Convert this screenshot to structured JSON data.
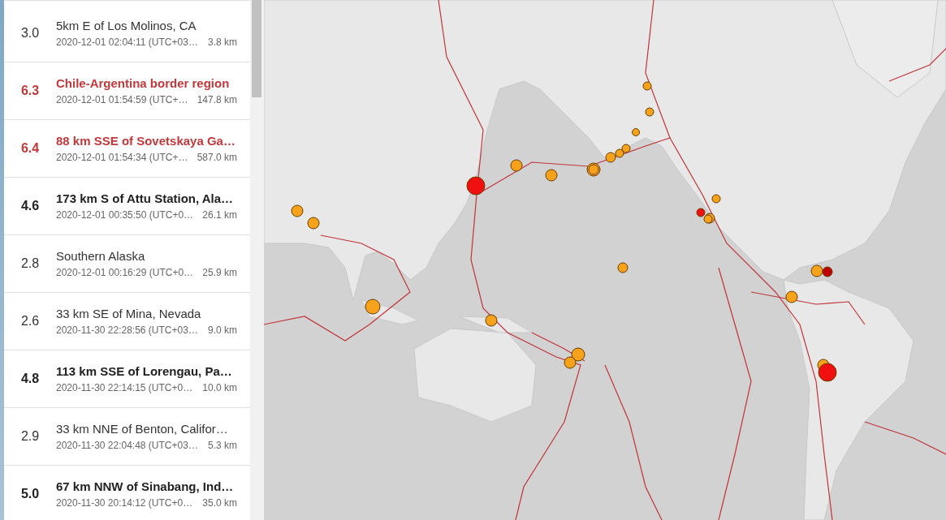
{
  "earthquakes": [
    {
      "magnitude": "3.0",
      "title": "5km E of Los Molinos, CA",
      "time": "2020-12-01 02:04:11 (UTC+03…",
      "depth": "3.8 km",
      "kind": "minor"
    },
    {
      "magnitude": "6.3",
      "title": "Chile-Argentina border region",
      "time": "2020-12-01 01:54:59 (UTC+…",
      "depth": "147.8 km",
      "kind": "significant"
    },
    {
      "magnitude": "6.4",
      "title": "88 km SSE of Sovetskaya Ga…",
      "time": "2020-12-01 01:54:34 (UTC+…",
      "depth": "587.0 km",
      "kind": "significant"
    },
    {
      "magnitude": "4.6",
      "title": "173 km S of Attu Station, Ala…",
      "time": "2020-12-01 00:35:50 (UTC+0…",
      "depth": "26.1 km",
      "kind": "moderate"
    },
    {
      "magnitude": "2.8",
      "title": "Southern Alaska",
      "time": "2020-12-01 00:16:29 (UTC+0…",
      "depth": "25.9 km",
      "kind": "minor"
    },
    {
      "magnitude": "2.6",
      "title": "33 km SE of Mina, Nevada",
      "time": "2020-11-30 22:28:56 (UTC+03…",
      "depth": "9.0 km",
      "kind": "minor"
    },
    {
      "magnitude": "4.8",
      "title": "113 km SSE of Lorengau, Pa…",
      "time": "2020-11-30 22:14:15 (UTC+0…",
      "depth": "10.0 km",
      "kind": "moderate"
    },
    {
      "magnitude": "2.9",
      "title": "33 km NNE of Benton, Califor…",
      "time": "2020-11-30 22:04:48 (UTC+03…",
      "depth": "5.3 km",
      "kind": "minor"
    },
    {
      "magnitude": "5.0",
      "title": "67 km NNW of Sinabang, Ind…",
      "time": "2020-11-30 20:14:12 (UTC+0…",
      "depth": "35.0 km",
      "kind": "moderate"
    }
  ]
}
